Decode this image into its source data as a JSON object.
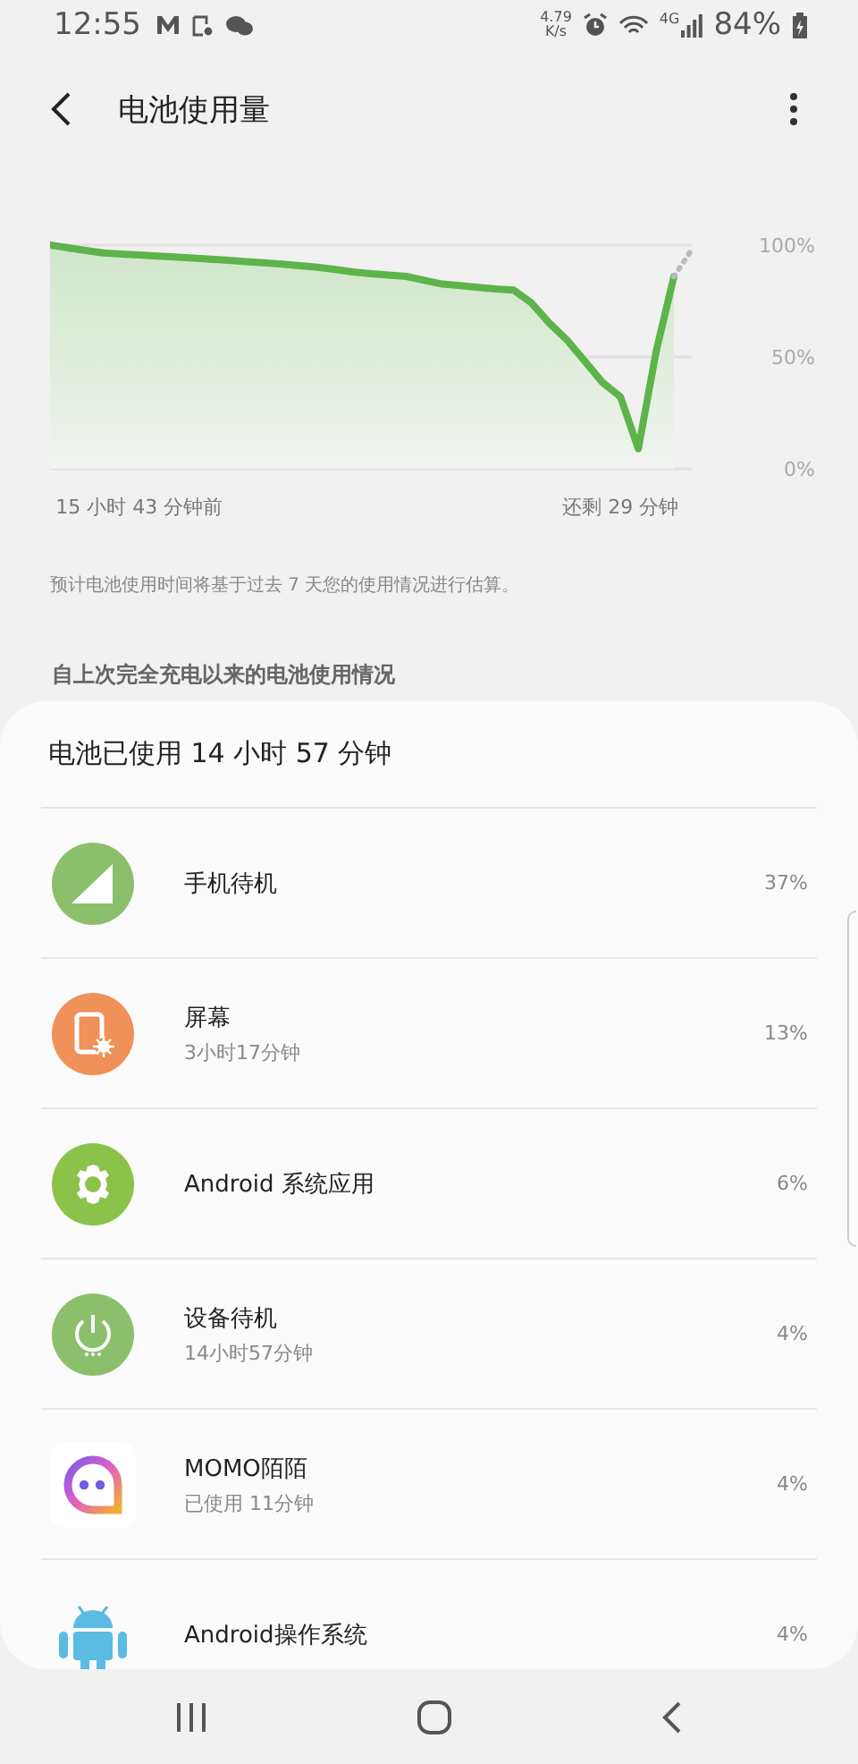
{
  "status_bar": {
    "time": "12:55",
    "speed_value": "4.79",
    "speed_unit": "K/s",
    "network": "4G",
    "battery": "84%"
  },
  "header": {
    "title": "电池使用量"
  },
  "chart": {
    "chart_data": {
      "type": "area",
      "categories": [
        null,
        null,
        null,
        null,
        null,
        "15 小时 43 分钟前",
        null,
        null,
        null,
        null,
        null,
        null,
        null,
        null,
        null,
        null,
        null,
        null,
        null,
        null,
        null,
        null,
        null,
        null,
        null,
        null,
        null,
        null,
        null,
        null,
        null,
        null,
        "还剩 29 分钟",
        null,
        null,
        null,
        null
      ],
      "series": [
        {
          "color": "#5db44a",
          "values": [
            100,
            98.8,
            97.6,
            96.5,
            96.0,
            95.6,
            95.1,
            94.7,
            94.2,
            93.7,
            93.2,
            92.6,
            92.1,
            91.5,
            90.8,
            90.1,
            89.1,
            88.0,
            87.2,
            86.6,
            86.0,
            84.2,
            82.6,
            81.9,
            81.1,
            80.4,
            79.9,
            74.2,
            65.2,
            57.5,
            48.1,
            38.6,
            32.2,
            9.0,
            52.6,
            85.9,
            null
          ]
        },
        {
          "type": "line",
          "line_style": "dotted",
          "color": "#b8bcc0",
          "values": [
            null,
            null,
            null,
            null,
            null,
            null,
            null,
            null,
            null,
            null,
            null,
            null,
            null,
            null,
            null,
            null,
            null,
            null,
            null,
            null,
            null,
            null,
            null,
            null,
            null,
            null,
            null,
            null,
            null,
            null,
            null,
            null,
            null,
            null,
            null,
            85.9,
            98
          ]
        }
      ],
      "ylim": [
        0,
        100
      ],
      "yticks": [
        {
          "value": 0,
          "label": "0%"
        },
        {
          "value": 50,
          "label": "50%"
        },
        {
          "value": 100,
          "label": "100%"
        }
      ]
    }
  },
  "note": "预计电池使用时间将基于过去 7 天您的使用情况进行估算。",
  "section_title": "自上次完全充电以来的电池使用情况",
  "usage": {
    "total": "电池已使用 14 小时 57 分钟",
    "items": [
      {
        "kind": "signal",
        "name": "手机待机",
        "percent": "37%"
      },
      {
        "kind": "screen",
        "name": "屏幕",
        "detail": "3小时17分钟",
        "percent": "13%"
      },
      {
        "kind": "gear",
        "name": "Android 系统应用",
        "percent": "6%"
      },
      {
        "kind": "power",
        "name": "设备待机",
        "detail": "14小时57分钟",
        "percent": "4%"
      },
      {
        "kind": "bubble",
        "name": "MOMO陌陌",
        "detail": "已使用 11分钟",
        "percent": "4%"
      },
      {
        "kind": "robot",
        "name": "Android操作系统",
        "percent": "4%"
      }
    ]
  }
}
